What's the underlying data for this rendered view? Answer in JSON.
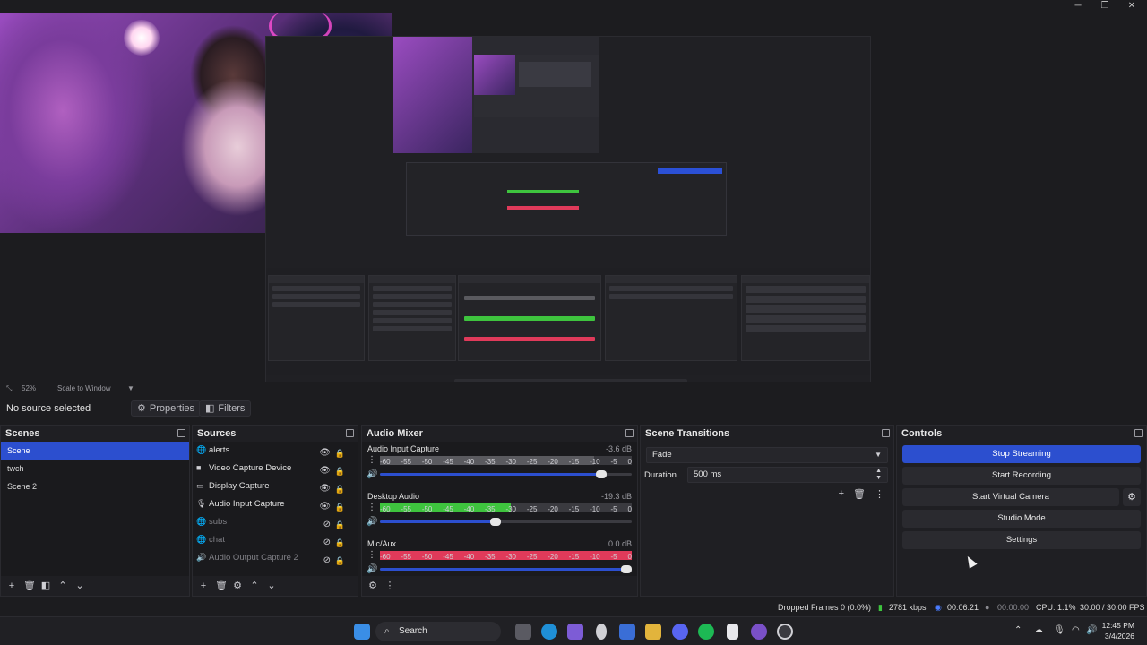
{
  "window": {
    "minimize_glyph": "─",
    "maximize_glyph": "❐",
    "close_glyph": "✕"
  },
  "preview_toolbar": {
    "zoom": "52%",
    "scale_mode": "Scale to Window"
  },
  "context_bar": {
    "selection_text": "No source selected",
    "properties_label": "Properties",
    "filters_label": "Filters"
  },
  "scenes": {
    "title": "Scenes",
    "items": [
      {
        "label": "Scene",
        "selected": true
      },
      {
        "label": "twch",
        "selected": false
      },
      {
        "label": "Scene 2",
        "selected": false
      }
    ]
  },
  "sources": {
    "title": "Sources",
    "items": [
      {
        "label": "alerts",
        "icon": "browser-source-icon",
        "visible": true
      },
      {
        "label": "Video Capture Device",
        "icon": "camera-icon",
        "visible": true
      },
      {
        "label": "Display Capture",
        "icon": "monitor-icon",
        "visible": true
      },
      {
        "label": "Audio Input Capture",
        "icon": "microphone-icon",
        "visible": true
      },
      {
        "label": "subs",
        "icon": "browser-source-icon",
        "visible": false
      },
      {
        "label": "chat",
        "icon": "browser-source-icon",
        "visible": false
      },
      {
        "label": "Audio Output Capture 2",
        "icon": "speaker-icon",
        "visible": false
      }
    ]
  },
  "audio_mixer": {
    "title": "Audio Mixer",
    "scale": [
      "-60",
      "-55",
      "-50",
      "-45",
      "-40",
      "-35",
      "-30",
      "-25",
      "-20",
      "-15",
      "-10",
      "-5",
      "0"
    ],
    "channels": [
      {
        "name": "Audio Input Capture",
        "db": "-3.6 dB",
        "level": 0.85,
        "meter_color": "#5a5a5f",
        "fader": 0.88
      },
      {
        "name": "Desktop Audio",
        "db": "-19.3 dB",
        "level": 0.52,
        "meter_color": "#3ec43e",
        "fader": 0.46
      },
      {
        "name": "Mic/Aux",
        "db": "0.0 dB",
        "level": 1.0,
        "meter_color": "#e03a5a",
        "fader": 0.98
      }
    ]
  },
  "scene_transitions": {
    "title": "Scene Transitions",
    "transition": "Fade",
    "duration_label": "Duration",
    "duration_value": "500 ms"
  },
  "controls": {
    "title": "Controls",
    "stop_streaming": "Stop Streaming",
    "start_recording": "Start Recording",
    "start_virtual_camera": "Start Virtual Camera",
    "studio_mode": "Studio Mode",
    "settings": "Settings"
  },
  "status_bar": {
    "dropped_frames": "Dropped Frames 0 (0.0%)",
    "bitrate": "2781 kbps",
    "stream_time": "00:06:21",
    "record_time": "00:00:00",
    "cpu": "CPU: 1.1%",
    "fps": "30.00 / 30.00 FPS"
  },
  "taskbar": {
    "search_placeholder": "Search",
    "time": "12:45 PM",
    "date": "3/4/2026"
  }
}
